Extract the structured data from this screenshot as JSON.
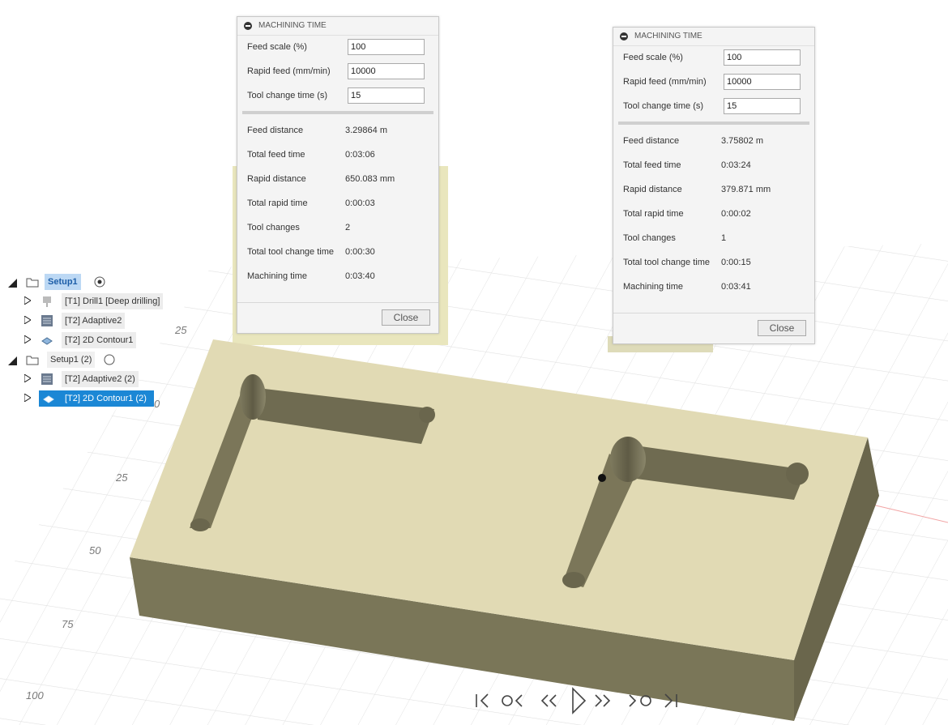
{
  "dialogs": [
    {
      "title": "MACHINING TIME",
      "inputs": [
        {
          "label": "Feed scale (%)",
          "value": "100"
        },
        {
          "label": "Rapid feed (mm/min)",
          "value": "10000"
        },
        {
          "label": "Tool change time (s)",
          "value": "15"
        }
      ],
      "stats": [
        {
          "label": "Feed distance",
          "value": "3.29864 m"
        },
        {
          "label": "Total feed time",
          "value": "0:03:06"
        },
        {
          "label": "Rapid distance",
          "value": "650.083 mm"
        },
        {
          "label": "Total rapid time",
          "value": "0:00:03"
        },
        {
          "label": "Tool changes",
          "value": "2"
        },
        {
          "label": "Total tool change time",
          "value": "0:00:30"
        },
        {
          "label": "Machining time",
          "value": "0:03:40"
        }
      ],
      "close_label": "Close"
    },
    {
      "title": "MACHINING TIME",
      "inputs": [
        {
          "label": "Feed scale (%)",
          "value": "100"
        },
        {
          "label": "Rapid feed (mm/min)",
          "value": "10000"
        },
        {
          "label": "Tool change time (s)",
          "value": "15"
        }
      ],
      "stats": [
        {
          "label": "Feed distance",
          "value": "3.75802 m"
        },
        {
          "label": "Total feed time",
          "value": "0:03:24"
        },
        {
          "label": "Rapid distance",
          "value": "379.871 mm"
        },
        {
          "label": "Total rapid time",
          "value": "0:00:02"
        },
        {
          "label": "Tool changes",
          "value": "1"
        },
        {
          "label": "Total tool change time",
          "value": "0:00:15"
        },
        {
          "label": "Machining time",
          "value": "0:03:41"
        }
      ],
      "close_label": "Close"
    }
  ],
  "browser": {
    "setup1": {
      "label": "Setup1",
      "ops": [
        "[T1] Drill1 [Deep drilling]",
        "[T2] Adaptive2",
        "[T2] 2D Contour1"
      ]
    },
    "setup2": {
      "label": "Setup1 (2)",
      "ops": [
        "[T2] Adaptive2 (2)",
        "[T2] 2D Contour1 (2)"
      ]
    }
  },
  "axis_labels": [
    "25",
    "0",
    "25",
    "50",
    "75",
    "100"
  ],
  "colors": {
    "stock_top": "#e0d9b2",
    "stock_front": "#797458",
    "stock_side": "#6b674c",
    "selection": "#1b87d5",
    "grid": "#dcdcdc"
  }
}
